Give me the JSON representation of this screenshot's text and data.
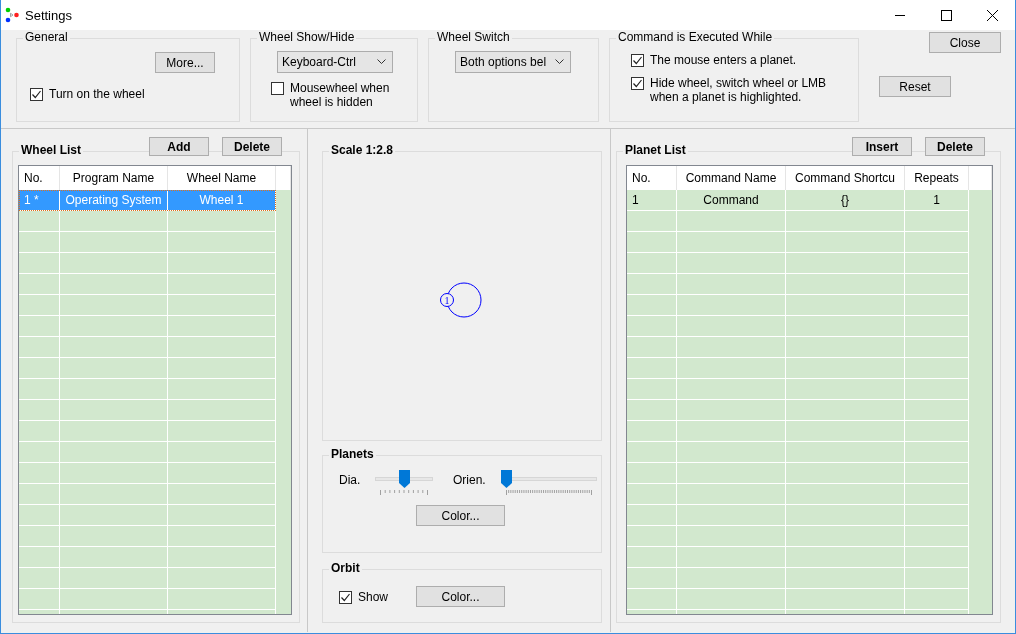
{
  "window": {
    "title": "Settings"
  },
  "general": {
    "title": "General",
    "more_button": "More...",
    "turn_on": {
      "label": "Turn on the wheel",
      "checked": true
    }
  },
  "show_hide": {
    "title": "Wheel Show/Hide",
    "dropdown": "Keyboard-Ctrl",
    "mousewheel": {
      "label": "Mousewheel when wheel is hidden",
      "checked": false
    }
  },
  "switch": {
    "title": "Wheel Switch",
    "dropdown": "Both options bel"
  },
  "command": {
    "title": "Command is Executed While",
    "options": [
      {
        "label": "The mouse enters a planet.",
        "checked": true
      },
      {
        "label": "Hide wheel, switch wheel or LMB when a planet is highlighted.",
        "checked": true
      }
    ]
  },
  "buttons": {
    "close": "Close",
    "reset": "Reset"
  },
  "wheel_list": {
    "title": "Wheel List",
    "buttons": [
      "Add",
      "Delete"
    ],
    "columns": [
      "No.",
      "Program Name",
      "Wheel Name"
    ],
    "rows": [
      {
        "cells": [
          "1 *",
          "Operating System",
          "Wheel 1"
        ],
        "selected": true
      }
    ]
  },
  "preview": {
    "title": "Scale 1:2.8",
    "planet_label": "1"
  },
  "planets": {
    "title": "Planets",
    "sliders": [
      {
        "label": "Dia.",
        "level": 0.5
      },
      {
        "label": "Orien.",
        "level": 0
      }
    ],
    "color_button": "Color..."
  },
  "orbit": {
    "title": "Orbit",
    "show": {
      "label": "Show",
      "checked": true
    },
    "color_button": "Color..."
  },
  "planet_list": {
    "title": "Planet List",
    "buttons": [
      "Insert",
      "Delete"
    ],
    "columns": [
      "No.",
      "Command Name",
      "Command Shortcu",
      "Repeats"
    ],
    "rows": [
      {
        "cells": [
          "1",
          "Command",
          "{}",
          "1"
        ],
        "selected": false
      }
    ]
  }
}
